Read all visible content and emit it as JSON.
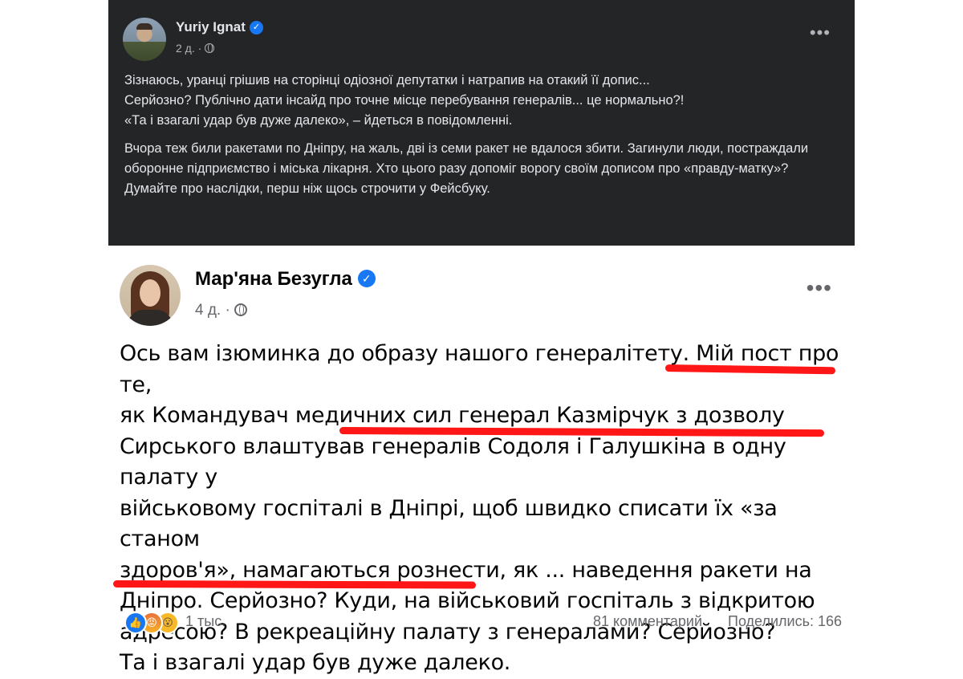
{
  "post_top": {
    "author": "Yuriy Ignat",
    "verified_icon": "verified-badge-icon",
    "time": "2 д.",
    "audience_icon": "globe-icon",
    "more_label": "•••",
    "paragraphs": [
      "Зізнаюсь, уранці грішив на сторінці одіозної депутатки і натрапив на отакий її допис...\nСерйозно? Публічно дати інсайд про точне місце перебування генералів... це нормально?!\n«Та і взагалі удар був дуже далеко», – йдеться в повідомленні.",
      "Вчора теж били ракетами по Дніпру, на жаль, дві із семи ракет не вдалося збити. Загинули люди, постраждали оборонне підприємство і міська лікарня. Хто цього разу допоміг ворогу своїм дописом про «правду-матку»?\nДумайте про наслідки, перш ніж щось строчити у Фейсбуку."
    ]
  },
  "post_bottom": {
    "author": "Мар'яна Безугла",
    "verified_icon": "verified-badge-icon",
    "time": "4 д.",
    "audience_icon": "globe-icon",
    "more_label": "•••",
    "lines": [
      "Ось вам ізюминка до образу нашого генералітету. Мій пост про те,",
      "як Командувач медичних сил генерал Казмірчук з дозволу",
      "Сирського влаштував генералів Содоля і Галушкіна в одну палату у",
      "військовому госпіталі в Дніпрі, щоб швидко списати їх «за станом",
      "здоров'я», намагаються рознести, як ... наведення ракети на",
      "Дніпро. Серйозно? Куди, на військовий госпіталь з відкритою",
      "адресою? В рекреаційну палату з генералами? Серйозно?",
      "Та і взагалі удар був дуже далеко."
    ],
    "highlight_color": "#ff1616",
    "reactions": [
      "like",
      "angry",
      "wow"
    ],
    "reaction_count": "1 тыс.",
    "comments": "81 комментарий",
    "shares": "Поделились: 166"
  }
}
